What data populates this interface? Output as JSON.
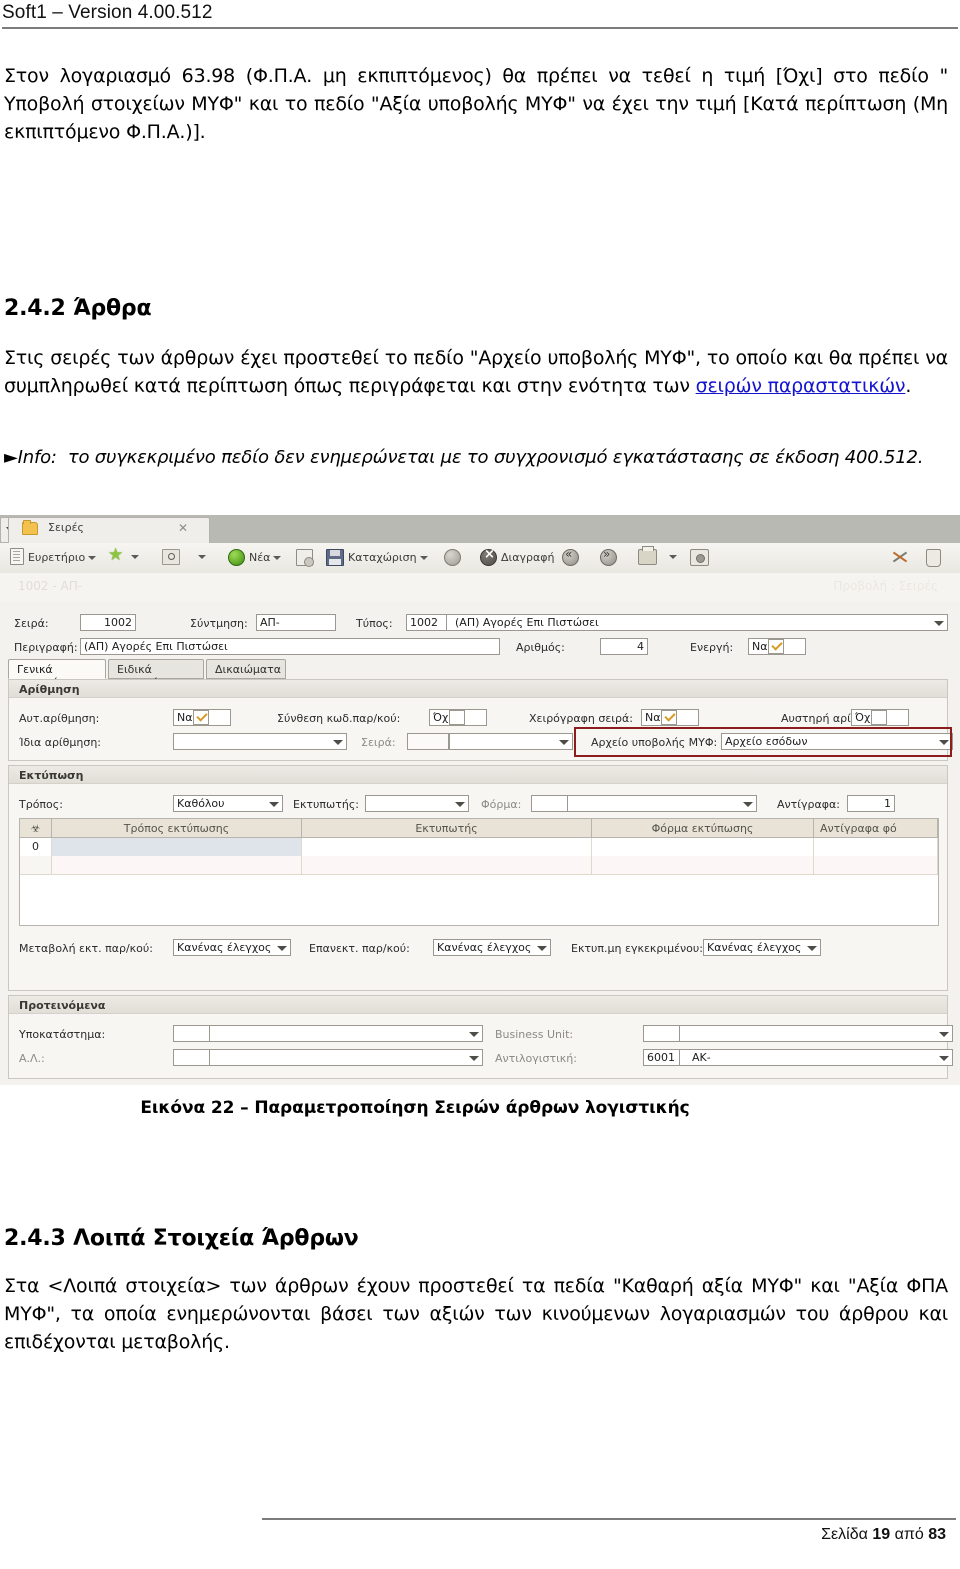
{
  "header": {
    "title": "Soft1 – Version 4.00.512"
  },
  "footer": {
    "text_prefix": "Σελίδα ",
    "page": "19",
    "text_mid": " από ",
    "total": "83"
  },
  "body": {
    "paragraph_1": "Στον λογαριασμό 63.98 (Φ.Π.Α. μη εκπιπτόμενος) θα πρέπει να τεθεί η τιμή [Όχι] στο πεδίο \" Υποβολή στοιχείων ΜΥΦ\" και το πεδίο \"Αξία υποβολής ΜΥΦ\" να έχει την τιμή [Κατά περίπτωση (Μη εκπιπτόμενο Φ.Π.Α.)].",
    "heading_242": "2.4.2  Άρθρα",
    "paragraph_2_a": "Στις σειρές των άρθρων έχει προστεθεί το πεδίο \"Αρχείο υποβολής ΜΥΦ\", το οποίο και θα πρέπει να συμπληρωθεί κατά περίπτωση όπως περιγράφεται και στην ενότητα των ",
    "paragraph_2_link": "σειρών παραστατικών",
    "paragraph_2_b": ".",
    "info_marker": "►Info:",
    "info_text": "το συγκεκριμένο πεδίο δεν ενημερώνεται με το συγχρονισμό εγκατάστασης σε έκδοση 400.512.",
    "caption": "Εικόνα 22 – Παραμετροποίηση Σειρών άρθρων λογιστικής",
    "heading_243": "2.4.3  Λοιπά Στοιχεία Άρθρων",
    "paragraph_3": "Στα <Λοιπά στοιχεία> των άρθρων έχουν προστεθεί τα πεδία \"Καθαρή αξία ΜΥΦ\" και \"Αξία ΦΠΑ ΜΥΦ\", τα οποία ενημερώνονται βάσει των αξιών των κινούμενων λογαριασμών του άρθρου και επιδέχονται μεταβολής."
  },
  "app": {
    "tab": {
      "label": "Σειρές",
      "close": "✕"
    },
    "toolbar": [
      {
        "name": "index",
        "label": "Ευρετήριο",
        "icon": "book-icon",
        "has_arrow": true
      },
      {
        "name": "favorite",
        "label": "",
        "icon": "star-icon",
        "has_arrow": true
      },
      {
        "name": "preview",
        "label": "",
        "icon": "magnifier-icon",
        "has_arrow": true
      },
      {
        "name": "new",
        "label": "Νέα",
        "icon": "new-icon",
        "has_arrow": true
      },
      {
        "name": "copy",
        "label": "",
        "icon": "copy-icon",
        "has_arrow": false
      },
      {
        "name": "save",
        "label": "Καταχώριση",
        "icon": "save-icon",
        "has_arrow": true
      },
      {
        "name": "refresh",
        "label": "",
        "icon": "refresh-icon",
        "has_arrow": true
      },
      {
        "name": "delete",
        "label": "Διαγραφή",
        "icon": "delete-icon",
        "has_arrow": false
      },
      {
        "name": "previous",
        "label": "",
        "icon": "previous-icon",
        "has_arrow": false
      },
      {
        "name": "next",
        "label": "",
        "icon": "next-icon",
        "has_arrow": false
      },
      {
        "name": "print",
        "label": "",
        "icon": "print-icon",
        "has_arrow": true
      },
      {
        "name": "screenshot",
        "label": "",
        "icon": "camera-icon",
        "has_arrow": false
      },
      {
        "name": "tools",
        "label": "",
        "icon": "tools-icon",
        "has_arrow": false
      },
      {
        "name": "export",
        "label": "",
        "icon": "export-icon",
        "has_arrow": false
      }
    ],
    "breadcrumb_left": "1002 - ΑΠ-",
    "breadcrumb_right": "Προβολή : Σειρές",
    "header_fields": {
      "seira_label": "Σειρά:",
      "seira_value": "1002",
      "syntmisi_label": "Σύντμηση:",
      "syntmisi_value": "ΑΠ-",
      "typos_label": "Τύπος:",
      "typos_code": "1002",
      "typos_value": "(ΑΠ) Αγορές Επι Πιστώσει",
      "perigrafi_label": "Περιγραφή:",
      "perigrafi_value": "(ΑΠ) Αγορές Επι Πιστώσει",
      "arithmos_label": "Αριθμός:",
      "arithmos_value": "4",
      "energi_label": "Ενεργή:",
      "energi_value": "Ναι"
    },
    "tabs": [
      {
        "label": "Γενικά στοιχεία",
        "active": true
      },
      {
        "label": "Ειδικά στοιχεία",
        "active": false
      },
      {
        "label": "Δικαιώματα",
        "active": false
      }
    ],
    "numbering_group": {
      "title": "Αρίθμηση",
      "auto_label": "Αυτ.αρίθμηση:",
      "auto_value": "Ναι",
      "composition_label": "Σύνθεση κωδ.παρ/κού:",
      "composition_value": "Όχι",
      "handwritten_label": "Χειρόγραφη σειρά:",
      "handwritten_value": "Ναι",
      "strict_label": "Αυστηρή αρίθμηση:",
      "strict_value": "Όχι",
      "same_label": "Ίδια αρίθμηση:",
      "same_value": "",
      "series_label": "Σειρά:",
      "series_value": "",
      "myf_label": "Αρχείο υποβολής ΜΥΦ:",
      "myf_value": "Αρχείο εσόδων",
      "highlight_color": "#8b1d1d"
    },
    "print_group": {
      "title": "Εκτύπωση",
      "mode_label": "Τρόπος:",
      "mode_value": "Καθόλου",
      "printer_label": "Εκτυπωτής:",
      "printer_value": "",
      "form_label": "Φόρμα:",
      "form_value": "",
      "copies_label": "Αντίγραφα:",
      "copies_value": "1",
      "grid_headers": [
        "Τρόπος εκτύπωσης",
        "Εκτυπωτής",
        "Φόρμα εκτύπωσης",
        "Αντίγραφα  φό"
      ],
      "grid_rows": [
        {
          "index": "0",
          "mode": "",
          "printer": "",
          "form": "",
          "copies": ""
        },
        {
          "index": "",
          "mode": "",
          "printer": "",
          "form": "",
          "copies": ""
        }
      ],
      "change_label": "Μεταβολή εκτ. παρ/κού:",
      "change_value": "Κανένας έλεγχος",
      "reprint_label": "Επανεκτ. παρ/κού:",
      "reprint_value": "Κανένας έλεγχος",
      "unapproved_label": "Εκτυπ.μη εγκεκριμένου:",
      "unapproved_value": "Κανένας έλεγχος"
    },
    "suggested_group": {
      "title": "Προτεινόμενα",
      "branch_label": "Υποκατάστημα:",
      "branch_code": "",
      "branch_value": "",
      "al_label": "Α.Λ.:",
      "al_code": "",
      "al_value": "",
      "bu_label": "Business Unit:",
      "bu_code": "",
      "bu_value": "",
      "counter_label": "Αντιλογιστική:",
      "counter_code": "6001",
      "counter_value": "ΑΚ-"
    }
  }
}
